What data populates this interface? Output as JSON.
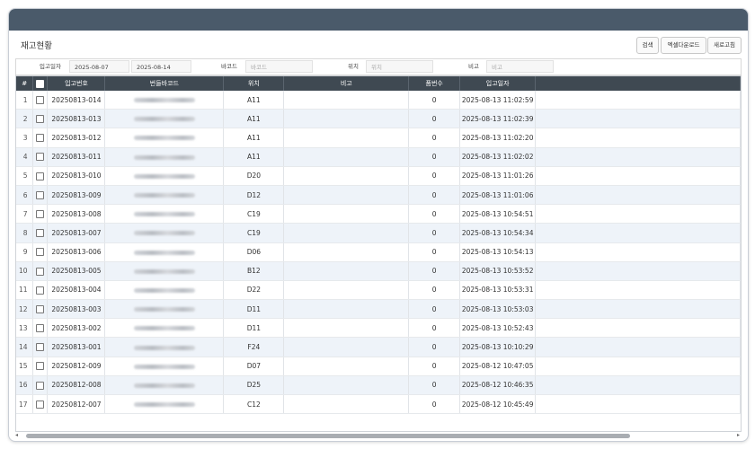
{
  "page": {
    "title": "재고현황"
  },
  "toolbar": {
    "search_label": "검색",
    "excel_label": "엑셀다운로드",
    "refresh_label": "새로고침"
  },
  "filters": {
    "date_label": "입고일자",
    "date_from": "2025-08-07",
    "date_to": "2025-08-14",
    "barcode_label": "바코드",
    "barcode_placeholder": "바코드",
    "location_label": "위치",
    "location_placeholder": "위치",
    "note_label": "비고",
    "note_placeholder": "비고"
  },
  "table": {
    "columns": [
      "#",
      "입고번호",
      "번들바코드",
      "위치",
      "비고",
      "품번수",
      "입고일자"
    ],
    "rows": [
      {
        "num": "1",
        "receipt": "20250813-014",
        "location": "A11",
        "note": "",
        "count": "0",
        "date": "2025-08-13 11:02:59"
      },
      {
        "num": "2",
        "receipt": "20250813-013",
        "location": "A11",
        "note": "",
        "count": "0",
        "date": "2025-08-13 11:02:39"
      },
      {
        "num": "3",
        "receipt": "20250813-012",
        "location": "A11",
        "note": "",
        "count": "0",
        "date": "2025-08-13 11:02:20"
      },
      {
        "num": "4",
        "receipt": "20250813-011",
        "location": "A11",
        "note": "",
        "count": "0",
        "date": "2025-08-13 11:02:02"
      },
      {
        "num": "5",
        "receipt": "20250813-010",
        "location": "D20",
        "note": "",
        "count": "0",
        "date": "2025-08-13 11:01:26"
      },
      {
        "num": "6",
        "receipt": "20250813-009",
        "location": "D12",
        "note": "",
        "count": "0",
        "date": "2025-08-13 11:01:06"
      },
      {
        "num": "7",
        "receipt": "20250813-008",
        "location": "C19",
        "note": "",
        "count": "0",
        "date": "2025-08-13 10:54:51"
      },
      {
        "num": "8",
        "receipt": "20250813-007",
        "location": "C19",
        "note": "",
        "count": "0",
        "date": "2025-08-13 10:54:34"
      },
      {
        "num": "9",
        "receipt": "20250813-006",
        "location": "D06",
        "note": "",
        "count": "0",
        "date": "2025-08-13 10:54:13"
      },
      {
        "num": "10",
        "receipt": "20250813-005",
        "location": "B12",
        "note": "",
        "count": "0",
        "date": "2025-08-13 10:53:52"
      },
      {
        "num": "11",
        "receipt": "20250813-004",
        "location": "D22",
        "note": "",
        "count": "0",
        "date": "2025-08-13 10:53:31"
      },
      {
        "num": "12",
        "receipt": "20250813-003",
        "location": "D11",
        "note": "",
        "count": "0",
        "date": "2025-08-13 10:53:03"
      },
      {
        "num": "13",
        "receipt": "20250813-002",
        "location": "D11",
        "note": "",
        "count": "0",
        "date": "2025-08-13 10:52:43"
      },
      {
        "num": "14",
        "receipt": "20250813-001",
        "location": "F24",
        "note": "",
        "count": "0",
        "date": "2025-08-13 10:10:29"
      },
      {
        "num": "15",
        "receipt": "20250812-009",
        "location": "D07",
        "note": "",
        "count": "0",
        "date": "2025-08-12 10:47:05"
      },
      {
        "num": "16",
        "receipt": "20250812-008",
        "location": "D25",
        "note": "",
        "count": "0",
        "date": "2025-08-12 10:46:35"
      },
      {
        "num": "17",
        "receipt": "20250812-007",
        "location": "C12",
        "note": "",
        "count": "0",
        "date": "2025-08-12 10:45:49"
      }
    ]
  },
  "scrollbar": {
    "left_arrow": "◂",
    "right_arrow": "▸"
  }
}
